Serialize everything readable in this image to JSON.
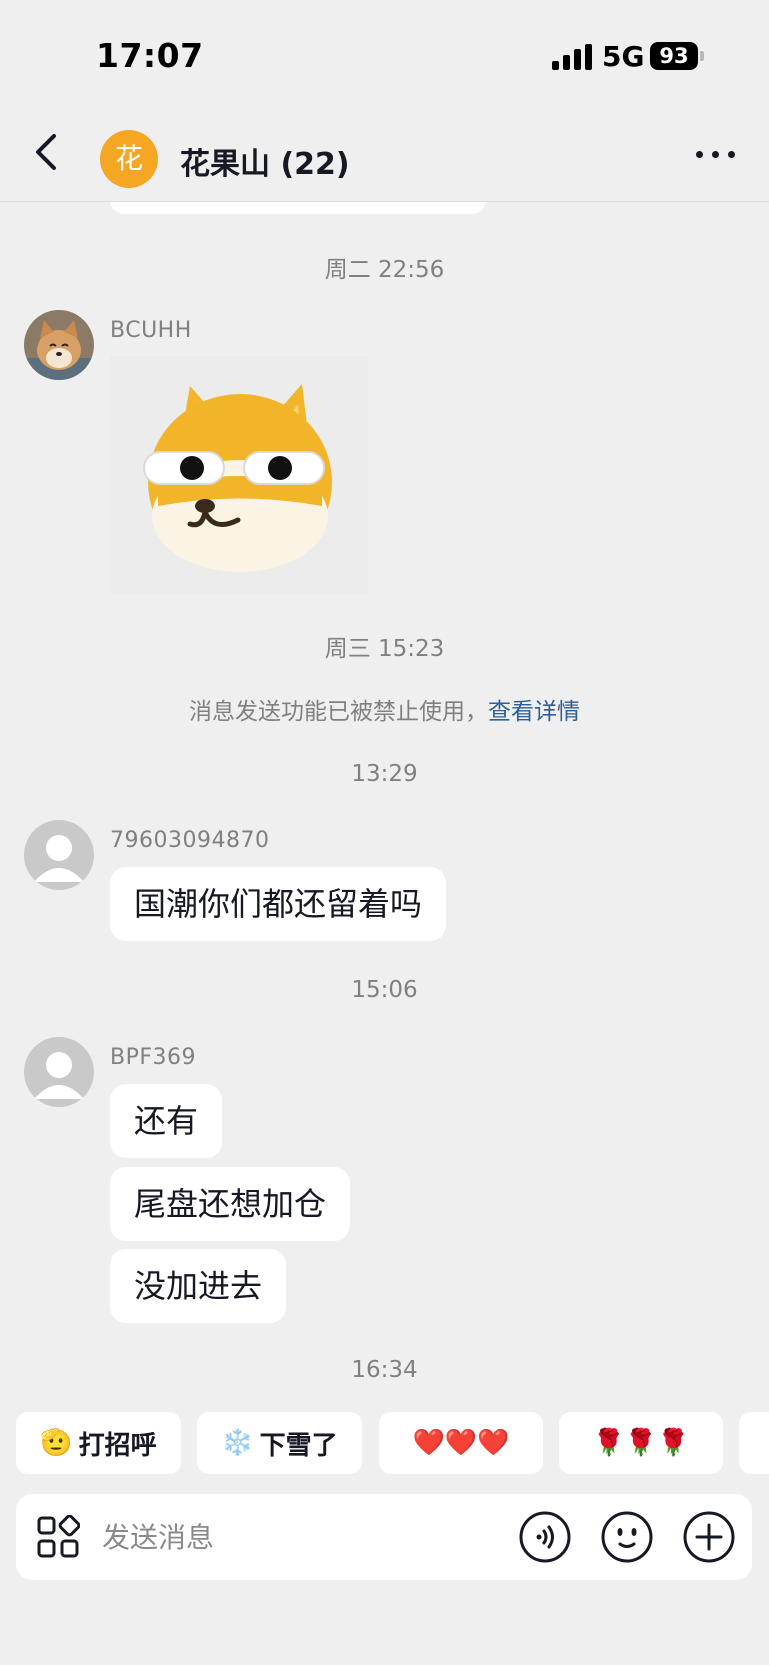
{
  "status_bar": {
    "time": "17:07",
    "network": "5G",
    "battery": "93"
  },
  "header": {
    "avatar_char": "花",
    "title": "花果山 (22)"
  },
  "messages": [
    {
      "time": "周二 22:56",
      "sender": "BCUHH",
      "sticker": "doge-sideeye-sticker"
    },
    {
      "time": "周三 15:23"
    },
    {
      "notice": "消息发送功能已被禁止使用，",
      "notice_link": "查看详情"
    },
    {
      "time": "13:29",
      "sender": "79603094870",
      "texts": [
        "国潮你们都还留着吗"
      ]
    },
    {
      "time": "15:06",
      "sender": "BPF369",
      "texts": [
        "还有",
        "尾盘还想加仓",
        "没加进去"
      ]
    },
    {
      "time": "16:34"
    }
  ],
  "quick_replies": [
    {
      "emoji": "🫡",
      "label": "打招呼"
    },
    {
      "emoji": "❄️",
      "label": "下雪了"
    },
    {
      "emoji": "❤️❤️❤️",
      "label": ""
    },
    {
      "emoji": "🌹🌹🌹",
      "label": ""
    }
  ],
  "input": {
    "placeholder": "发送消息"
  },
  "colors": {
    "background": "#efefef",
    "group_avatar": "#f5a623",
    "link": "#2b5e9c",
    "secondary_text": "#808080"
  }
}
